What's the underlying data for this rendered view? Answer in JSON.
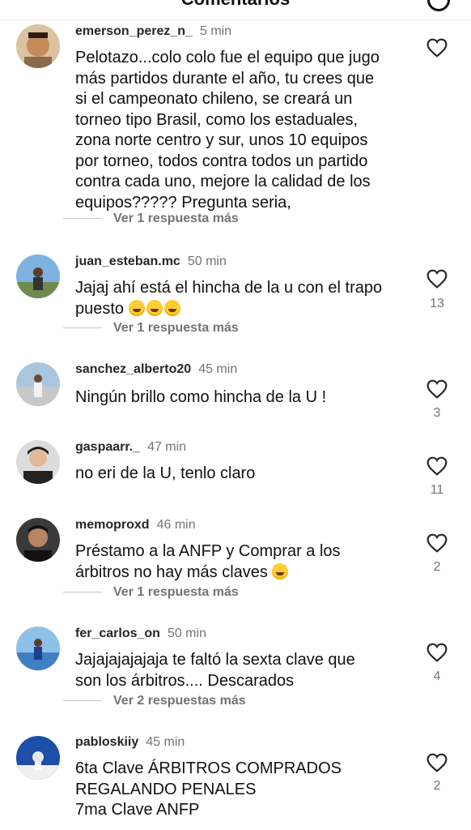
{
  "header": {
    "title": "Comentarios"
  },
  "comments": [
    {
      "username": "emerson_perez_n_",
      "time": "5 min",
      "text": [
        "Pelotazo...colo colo fue el equipo que jugo",
        "más partidos durante el año, tu crees que",
        "si el campeonato chileno, se creará un",
        "torneo tipo Brasil, como los estaduales,",
        "zona norte centro y sur, unos 10 equipos",
        "por torneo, todos contra todos un partido",
        "contra cada uno, mejore la calidad de los",
        "equipos????? Pregunta seria,"
      ],
      "replies": "Ver 1 respuesta más",
      "likes": ""
    },
    {
      "username": "juan_esteban.mc",
      "time": "50 min",
      "text": [
        "Jajaj ahí está el hincha de la u con el trapo",
        "puesto"
      ],
      "replies": "Ver 1 respuesta más",
      "likes": "13"
    },
    {
      "username": "sanchez_alberto20",
      "time": "45 min",
      "text": [
        "Ningún brillo como hincha de la U !"
      ],
      "replies": "",
      "likes": "3"
    },
    {
      "username": "gaspaarr._",
      "time": "47 min",
      "text": [
        "no eri de la U, tenlo claro"
      ],
      "replies": "",
      "likes": "11"
    },
    {
      "username": "memoproxd",
      "time": "46 min",
      "text": [
        "Préstamo a la ANFP y Comprar a los",
        "árbitros no hay más claves"
      ],
      "replies": "Ver 1 respuesta más",
      "likes": "2"
    },
    {
      "username": "fer_carlos_on",
      "time": "50 min",
      "text": [
        "Jajajajajajaja te faltó la sexta clave que",
        "son los árbitros.... Descarados"
      ],
      "replies": "Ver 2 respuestas más",
      "likes": "4"
    },
    {
      "username": "pabloskiiy",
      "time": "45 min",
      "text": [
        "6ta Clave ÁRBITROS COMPRADOS",
        "REGALANDO PENALES",
        "7ma Clave ANFP"
      ],
      "replies": "",
      "likes": "2"
    }
  ],
  "icons": {
    "like": "heart-outline-icon",
    "share": "share-circle-icon"
  },
  "colors": {
    "text": "#262626",
    "secondary": "#737373",
    "background": "#ffffff"
  }
}
